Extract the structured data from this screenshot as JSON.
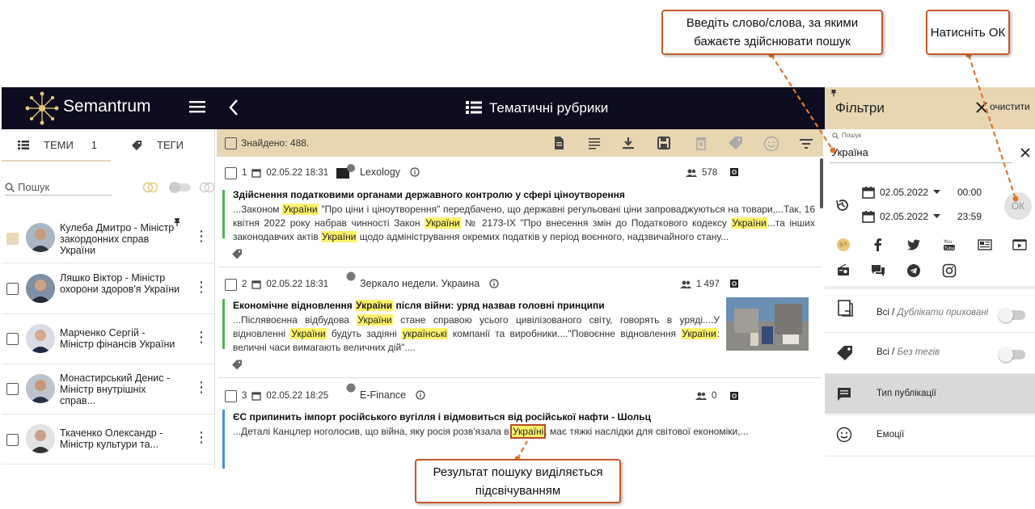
{
  "app": {
    "brand": "Semantrum",
    "section_title": "Тематичні рубрики"
  },
  "sidebar": {
    "tabs": [
      {
        "label": "ТЕМИ",
        "count": "1"
      },
      {
        "label": "ТЕГИ"
      }
    ],
    "search_placeholder": "Пошук",
    "people": [
      {
        "name": "Кулеба Дмитро - Міністр закордонних справ України",
        "checked": true,
        "pinned": true
      },
      {
        "name": "Ляшко Віктор - Міністр охорони здоров'я України",
        "checked": false
      },
      {
        "name": "Марченко Сергій - Міністр фінансів України",
        "checked": false
      },
      {
        "name": "Монастирський Денис - Міністр внутрішніх справ...",
        "checked": false
      },
      {
        "name": "Ткаченко Олександр - Міністр культури та...",
        "checked": false
      }
    ]
  },
  "results": {
    "found": "Знайдено: 488.",
    "articles": [
      {
        "num": "1",
        "datetime": "02.05.22 18:31",
        "source": "Lexology",
        "audience": "578",
        "title": "Здійснення податковими органами державного контролю у сфері ціноутворення",
        "body": [
          {
            "t": "...Законом "
          },
          {
            "h": "України"
          },
          {
            "t": " \"Про ціни і ціноутворення\" передбачено, що державні регульовані ціни запроваджуються на товари,...Так, 16 квітня 2022 року набрав чинності Закон "
          },
          {
            "h": "України"
          },
          {
            "t": " № 2173-IX \"Про внесення змін до Податкового кодексу "
          },
          {
            "h": "України"
          },
          {
            "t": "...та інших законодавчих актів "
          },
          {
            "h": "України"
          },
          {
            "t": " щодо адміністрування окремих податків у період воєнного, надзвичайного стану..."
          }
        ]
      },
      {
        "num": "2",
        "datetime": "02.05.22 18:31",
        "source": "Зеркало недели. Украина",
        "audience": "1 497",
        "title_parts": [
          {
            "t": "Економічне відновлення "
          },
          {
            "h": "України"
          },
          {
            "t": " після війни: уряд назвав головні принципи"
          }
        ],
        "body": [
          {
            "t": "...Післявоєнна відбудова "
          },
          {
            "h": "України"
          },
          {
            "t": " стане справою усього цивілізованого світу, говорять в уряді....У відновленні "
          },
          {
            "h": "України"
          },
          {
            "t": " будуть задіяні "
          },
          {
            "h": "українські"
          },
          {
            "t": " компанії та виробники....\"Повоєнне відновлення "
          },
          {
            "h": "України"
          },
          {
            "t": ": величні часи вимагають величних дій\"...."
          }
        ]
      },
      {
        "num": "3",
        "datetime": "02.05.22 18:25",
        "source": "E-Finance",
        "audience": "0",
        "title": "ЄС припинить імпорт російського вугілля і відмовиться від російської нафти - Шольц",
        "body": [
          {
            "t": "...Деталі Канцлер ноголосив, що війна, яку росія розв'язала в "
          },
          {
            "hb": "Україні"
          },
          {
            "t": ", має тяжкі наслідки для світової економіки,..."
          }
        ]
      }
    ]
  },
  "filters": {
    "title": "Фільтри",
    "clear": "очистити",
    "search_label": "Пошук",
    "search_value": "Україна",
    "date_from": "02.05.2022",
    "time_from": "00:00",
    "date_to": "02.05.2022",
    "time_to": "23:59",
    "ok": "ОК",
    "rows": [
      {
        "label_main": "Всі / ",
        "label_sub": "Дублікати приховані",
        "toggle": true
      },
      {
        "label_main": "Всі / ",
        "label_sub": "Без тегів",
        "toggle": true
      },
      {
        "label_main": "Тип публікації",
        "label_sub": "",
        "toggle": false,
        "highlight": true
      },
      {
        "label_main": "Емоції",
        "label_sub": "",
        "toggle": false
      }
    ]
  },
  "callouts": {
    "search_hint": "Введіть слово/слова, за якими бажаєте здійснювати пошук",
    "ok_hint": "Натисніть ОК",
    "result_hint": "Результат пошуку виділяється підсвічуванням"
  },
  "colors": {
    "accent": "#e8d6b3",
    "topbar": "#0d0d1f",
    "highlight": "#fff36b",
    "callout_border": "#c55a2b"
  }
}
